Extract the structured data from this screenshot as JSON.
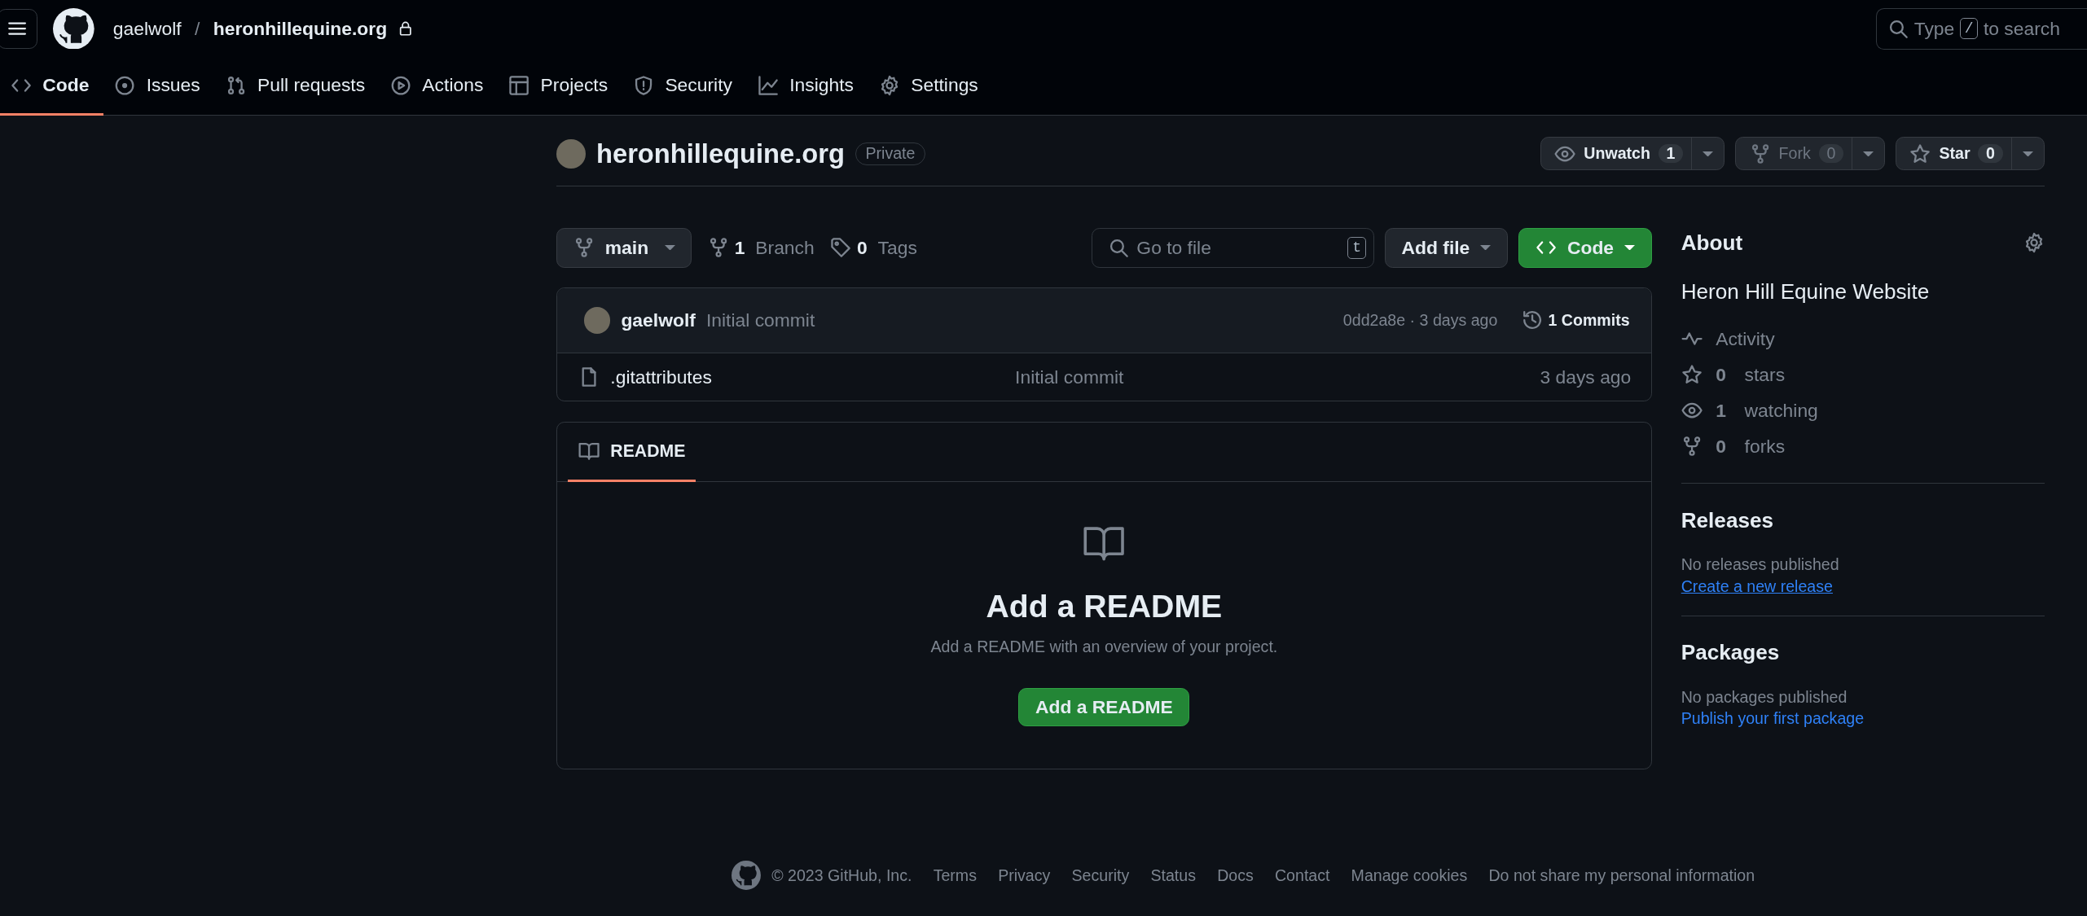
{
  "header": {
    "owner": "gaelwolf",
    "separator": "/",
    "repo": "heronhillequine.org",
    "search": {
      "before": "Type",
      "key": "/",
      "after": "to search"
    }
  },
  "tabs": [
    {
      "kind": "code",
      "label": "Code",
      "selected": true
    },
    {
      "kind": "issues",
      "label": "Issues",
      "selected": false
    },
    {
      "kind": "pulls",
      "label": "Pull requests",
      "selected": false
    },
    {
      "kind": "actions",
      "label": "Actions",
      "selected": false
    },
    {
      "kind": "projects",
      "label": "Projects",
      "selected": false
    },
    {
      "kind": "security",
      "label": "Security",
      "selected": false
    },
    {
      "kind": "insights",
      "label": "Insights",
      "selected": false
    },
    {
      "kind": "settings",
      "label": "Settings",
      "selected": false
    }
  ],
  "repo": {
    "name": "heronhillequine.org",
    "visibility": "Private",
    "actions": [
      {
        "kind": "watch",
        "label": "Unwatch",
        "count": "1",
        "disabled": false
      },
      {
        "kind": "fork",
        "label": "Fork",
        "count": "0",
        "disabled": true
      },
      {
        "kind": "star",
        "label": "Star",
        "count": "0",
        "disabled": false
      }
    ]
  },
  "toolbar": {
    "branch": "main",
    "branches": {
      "count": "1",
      "label": "Branch"
    },
    "tags": {
      "count": "0",
      "label": "Tags"
    },
    "go_to_file": {
      "placeholder": "Go to file",
      "key": "t"
    },
    "add_file": "Add file",
    "code_button": "Code"
  },
  "commit": {
    "author": "gaelwolf",
    "message": "Initial commit",
    "hash": "0dd2a8e · 3 days ago",
    "commits": "1 Commits"
  },
  "files": [
    {
      "name": ".gitattributes",
      "message": "Initial commit",
      "time": "3 days ago"
    }
  ],
  "readme": {
    "tab": "README",
    "title": "Add a README",
    "text": "Add a README with an overview of your project.",
    "button": "Add a README"
  },
  "about": {
    "title": "About",
    "description": "Heron Hill Equine Website",
    "stats": [
      {
        "kind": "activity",
        "label": "Activity"
      },
      {
        "kind": "stars",
        "count": "0",
        "label": "stars"
      },
      {
        "kind": "watching",
        "count": "1",
        "label": "watching"
      },
      {
        "kind": "forks",
        "count": "0",
        "label": "forks"
      }
    ]
  },
  "sections": [
    {
      "title": "Releases",
      "note": "No releases published",
      "link": "Create a new release",
      "underlined": true
    },
    {
      "title": "Packages",
      "note": "No packages published",
      "link": "Publish your first package",
      "underlined": false
    }
  ],
  "footer": {
    "copyright": "© 2023 GitHub, Inc.",
    "links": [
      "Terms",
      "Privacy",
      "Security",
      "Status",
      "Docs",
      "Contact",
      "Manage cookies",
      "Do not share my personal information"
    ]
  }
}
